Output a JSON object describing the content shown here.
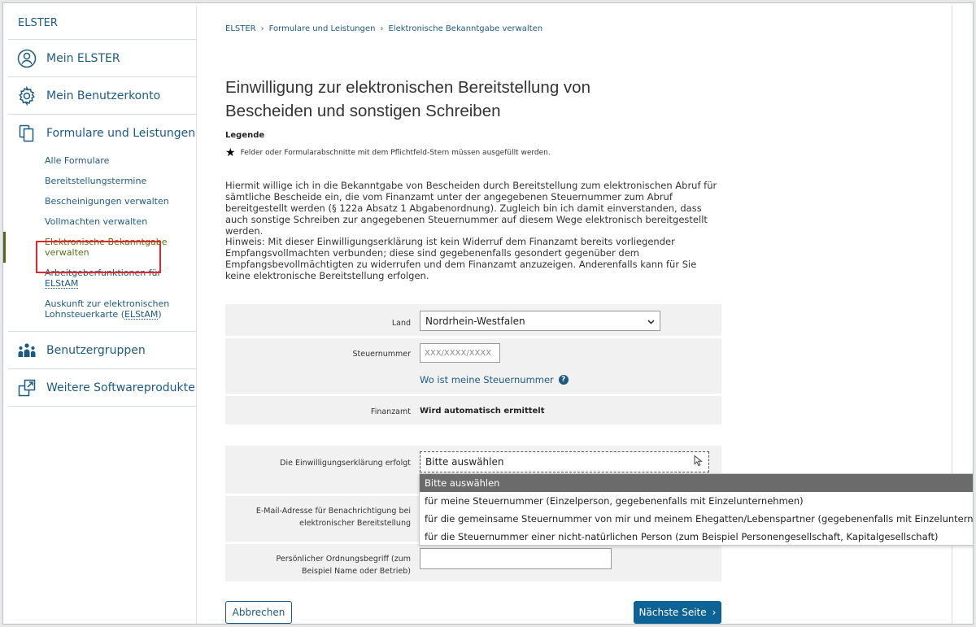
{
  "sidebar": {
    "brand": "ELSTER",
    "nav": [
      {
        "label": "Mein ELSTER",
        "icon": "user-circle-icon"
      },
      {
        "label": "Mein Benutzerkonto",
        "icon": "gear-icon"
      },
      {
        "label": "Formulare und Leistungen",
        "icon": "documents-icon"
      }
    ],
    "subitems": [
      "Alle Formulare",
      "Bereitstellungstermine",
      "Bescheinigungen verwalten",
      "Vollmachten verwalten",
      "Elektronische Bekanntgabe verwalten",
      "Arbeitgeberfunktionen für ",
      "Auskunft zur elektronischen Lohnsteuerkarte (",
      "ELStAM",
      ")"
    ],
    "nav_bottom": [
      {
        "label": "Benutzergruppen",
        "icon": "user-group-icon"
      },
      {
        "label": "Weitere Softwareprodukte",
        "icon": "external-window-icon"
      }
    ]
  },
  "breadcrumb": [
    "ELSTER",
    "Formulare und Leistungen",
    "Elektronische Bekanntgabe verwalten"
  ],
  "page": {
    "title": "Einwilligung zur elektronischen Bereitstellung von Bescheiden und sonstigen Schreiben",
    "legend_title": "Legende",
    "legend_text": "Felder oder Formularabschnitte mit dem Pflichtfeld-Stern müssen ausgefüllt werden.",
    "para1": "Hiermit willige ich in die Bekanntgabe von Bescheiden durch Bereitstellung zum elektronischen Abruf für sämtliche Bescheide ein, die vom Finanzamt unter der angegebenen Steuernummer zum Abruf bereitgestellt werden (§ 122a Absatz 1 Abgabenordnung). Zugleich bin ich damit einverstanden, dass auch sonstige Schreiben zur angegebenen Steuernummer auf diesem Wege elektronisch bereitgestellt werden.",
    "para2": "Hinweis: Mit dieser Einwilligungserklärung ist kein Widerruf dem Finanzamt bereits vorliegender Empfangsvollmachten verbunden; diese sind gegebenenfalls gesondert gegenüber dem Empfangsbevollmächtigten zu widerrufen und dem Finanzamt anzuzeigen. Anderenfalls kann für Sie keine elektronische Bereitstellung erfolgen."
  },
  "form": {
    "land_label": "Land",
    "land_value": "Nordrhein-Westfalen",
    "steuernummer_label": "Steuernummer",
    "steuernummer_placeholder": "XXX/XXXX/XXXX",
    "steuernummer_help": "Wo ist meine Steuernummer",
    "finanzamt_label": "Finanzamt",
    "finanzamt_value": "Wird automatisch ermittelt",
    "einwilligung_label": "Die Einwilligungserklärung erfolgt",
    "einwilligung_value": "Bitte auswählen",
    "email_label": "E-Mail-Adresse für Benachrichtigung bei elektronischer Bereitstellung",
    "ordnung_label": "Persönlicher Ordnungsbegriff (zum Beispiel Name oder Betrieb)",
    "dropdown_options": [
      "Bitte auswählen",
      "für meine Steuernummer (Einzelperson, gegebenenfalls mit Einzelunternehmen)",
      "für die gemeinsame Steuernummer von mir und meinem Ehegatten/Lebenspartner (gegebenenfalls mit Einzelunternehmen)",
      "für die Steuernummer einer nicht-natürlichen Person (zum Beispiel Personengesellschaft, Kapitalgesellschaft)"
    ]
  },
  "buttons": {
    "cancel": "Abbrechen",
    "next": "Nächste Seite"
  },
  "colors": {
    "link": "#1d5a82",
    "primary_button": "#0d6296",
    "highlight": "#e0292f",
    "active_marker": "#56661b"
  }
}
